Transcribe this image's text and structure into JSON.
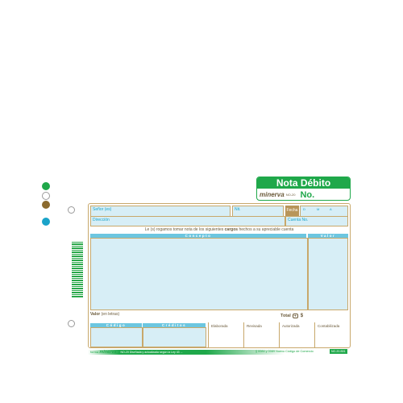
{
  "title": "Nota Débito",
  "brand": {
    "name": "minerva",
    "code": "NO-20",
    "number_label": "No."
  },
  "fields": {
    "senor": "Señor (es)",
    "nit": "Nit.",
    "fecha": "Fecha",
    "d": "D",
    "m": "M",
    "a": "A",
    "direccion": "Dirección",
    "cuenta": "Cuenta No."
  },
  "note": {
    "before": "Le (s) rogamos tomar nota de los siguientes ",
    "bold": "cargos",
    "after": " hechos a su apreciable cuenta"
  },
  "columns": {
    "concepto": "Concepto",
    "valor": "Valor",
    "codigo": "Código",
    "creditos": "Créditos"
  },
  "valor_letras": {
    "label": "Valor",
    "hint": " (en letras)"
  },
  "total": {
    "label": "Total",
    "currency": "$"
  },
  "signatures": [
    "Elaborada",
    "Revisada",
    "Autorizada",
    "Contabilizada"
  ],
  "footer": {
    "prefix": "forma",
    "brand": "minerva",
    "note": "NO-20 Diseñada y actualizada según la Ley 43 ...",
    "legal": "§ 0084 y 0089 Nuevo Código de Comercio",
    "code": "NO-20-B01"
  },
  "colors": {
    "green": "#1fa84a",
    "cyan": "#1aa3c9",
    "brown": "#8b6a2e",
    "field_fill": "#d7eef6"
  }
}
